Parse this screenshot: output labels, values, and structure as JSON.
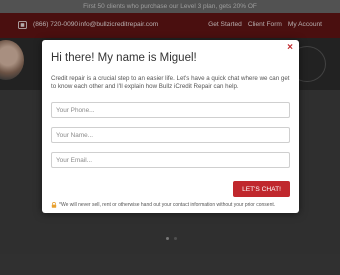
{
  "promo": {
    "text": "First 50 clients who purchase our Level 3 plan, gets 20% OF"
  },
  "topbar": {
    "phone": "(866) 720-0090",
    "email": "info@bullzicreditrepair.com",
    "nav": [
      "Get Started",
      "Client Form",
      "My Account"
    ]
  },
  "modal": {
    "title": "Hi there! My name is Miguel!",
    "intro": "Credit repair is a crucial step to an easier life. Let's have a quick chat where we can get to know each other and I'll explain how Bullz iCredit Repair can help.",
    "phone_placeholder": "Your Phone...",
    "name_placeholder": "Your Name...",
    "email_placeholder": "Your Email...",
    "submit_label": "LET'S CHAT!",
    "privacy": "*We will never sell, rent or otherwise hand out your contact information without your prior consent.",
    "close_symbol": "×"
  },
  "colors": {
    "accent": "#c0282d",
    "topbar": "#5f1414"
  },
  "icons": {
    "phone": "phone-icon",
    "lock": "lock-icon",
    "close": "close-icon"
  }
}
